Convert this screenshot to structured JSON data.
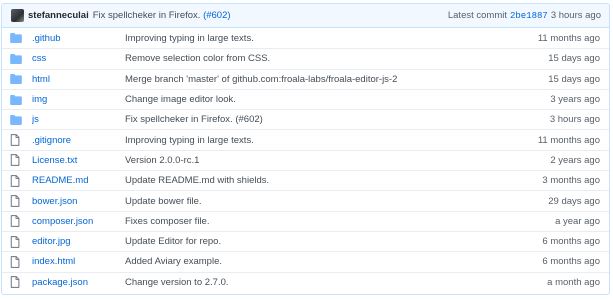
{
  "commit": {
    "author": "stefanneculai",
    "message_text": "Fix spellcheker in Firefox.",
    "message_link": "(#602)",
    "latest_label": "Latest commit",
    "sha": "2be1887",
    "age": "3 hours ago"
  },
  "files": [
    {
      "type": "folder",
      "name": ".github",
      "message": "Improving typing in large texts.",
      "age": "11 months ago"
    },
    {
      "type": "folder",
      "name": "css",
      "message": "Remove selection color from CSS.",
      "age": "15 days ago"
    },
    {
      "type": "folder",
      "name": "html",
      "message": "Merge branch 'master' of github.com:froala-labs/froala-editor-js-2",
      "age": "15 days ago"
    },
    {
      "type": "folder",
      "name": "img",
      "message": "Change image editor look.",
      "age": "3 years ago"
    },
    {
      "type": "folder",
      "name": "js",
      "message": "Fix spellcheker in Firefox. (#602)",
      "age": "3 hours ago"
    },
    {
      "type": "file",
      "name": ".gitignore",
      "message": "Improving typing in large texts.",
      "age": "11 months ago"
    },
    {
      "type": "file",
      "name": "License.txt",
      "message": "Version 2.0.0-rc.1",
      "age": "2 years ago"
    },
    {
      "type": "file",
      "name": "README.md",
      "message": "Update README.md with shields.",
      "age": "3 months ago"
    },
    {
      "type": "file",
      "name": "bower.json",
      "message": "Update bower file.",
      "age": "29 days ago"
    },
    {
      "type": "file",
      "name": "composer.json",
      "message": "Fixes composer file.",
      "age": "a year ago"
    },
    {
      "type": "file",
      "name": "editor.jpg",
      "message": "Update Editor for repo.",
      "age": "6 months ago"
    },
    {
      "type": "file",
      "name": "index.html",
      "message": "Added Aviary example.",
      "age": "6 months ago"
    },
    {
      "type": "file",
      "name": "package.json",
      "message": "Change version to 2.7.0.",
      "age": "a month ago"
    }
  ],
  "colors": {
    "folder_icon": "#79b8ff",
    "file_icon": "#6a737d",
    "link": "#0366d6",
    "commit_bar": "#f1f8ff"
  }
}
